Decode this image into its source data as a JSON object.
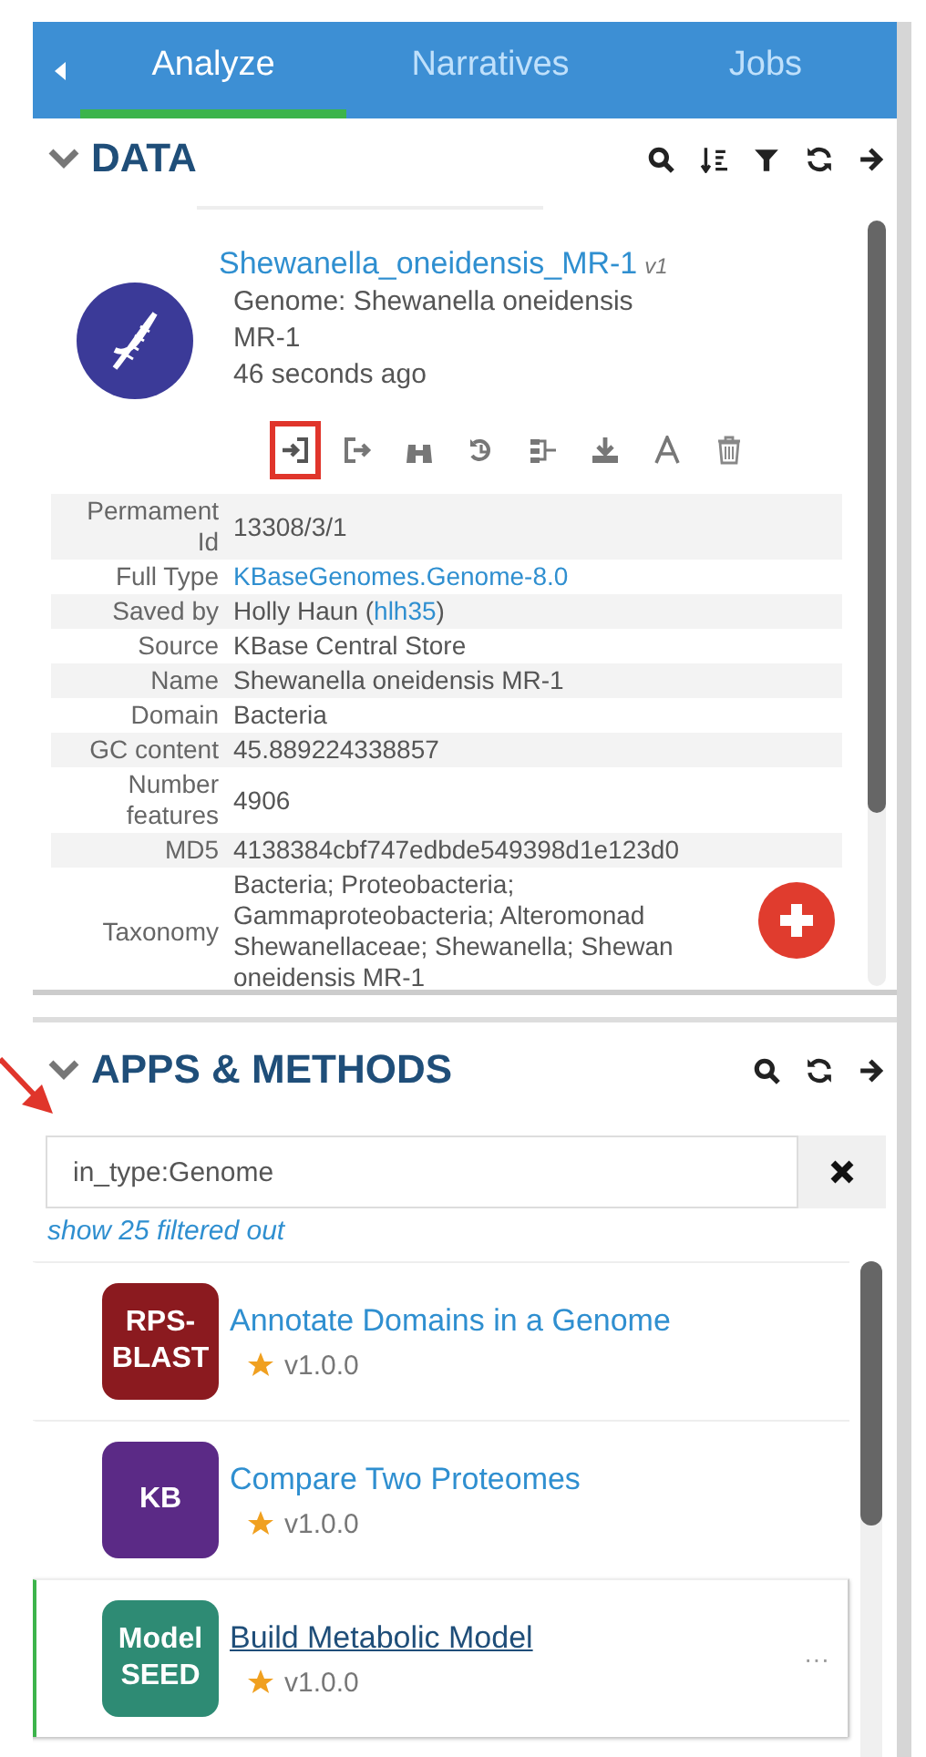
{
  "tabs": [
    {
      "label": "Analyze",
      "selected": true
    },
    {
      "label": "Narratives",
      "selected": false
    },
    {
      "label": "Jobs",
      "selected": false
    }
  ],
  "data": {
    "title": "DATA",
    "expanded": true,
    "object": {
      "name": "Shewanella_oneidensis_MR-1",
      "version": "v1",
      "type_lines": [
        "Genome: Shewanella oneidensis",
        "MR-1"
      ],
      "time": "46 seconds ago"
    },
    "actions": [
      {
        "highlighted": true
      },
      {
        "highlighted": false
      },
      {
        "highlighted": false
      },
      {
        "highlighted": false
      },
      {
        "highlighted": false
      },
      {
        "highlighted": false
      },
      {
        "highlighted": false
      },
      {
        "highlighted": false
      }
    ],
    "rows": [
      {
        "label": "Permament Id",
        "value": [
          {
            "text": "13308/3/1"
          }
        ]
      },
      {
        "label": "Full Type",
        "value": [
          {
            "text": "KBaseGenomes.Genome-8.0",
            "link": true
          }
        ]
      },
      {
        "label": "Saved by",
        "value": [
          {
            "text": "Holly Haun ("
          },
          {
            "text": "hlh35",
            "link": true
          },
          {
            "text": ")"
          }
        ]
      },
      {
        "label": "Source",
        "value": [
          {
            "text": "KBase Central Store"
          }
        ]
      },
      {
        "label": "Name",
        "value": [
          {
            "text": "Shewanella oneidensis MR-1"
          }
        ]
      },
      {
        "label": "Domain",
        "value": [
          {
            "text": "Bacteria"
          }
        ]
      },
      {
        "label": "GC content",
        "value": [
          {
            "text": "45.889224338857"
          }
        ]
      },
      {
        "label": "Number features",
        "value": [
          {
            "text": "4906"
          }
        ]
      },
      {
        "label": "MD5",
        "value": [
          {
            "text": "4138384cbf747edbde549398d1e123d0"
          }
        ]
      },
      {
        "label": "Taxonomy",
        "lines": [
          "Bacteria; Proteobacteria;",
          "Gammaproteobacteria; Alteromonad",
          "Shewanellaceae; Shewanella; Shewan",
          "oneidensis MR-1"
        ]
      }
    ]
  },
  "apps": {
    "title": "APPS & METHODS",
    "expanded": true,
    "filter": {
      "value": "in_type:Genome"
    },
    "filtered_link": "show 25 filtered out",
    "items": [
      {
        "logo": [
          "RPS-",
          "BLAST"
        ],
        "color": "#8b1a1f",
        "title": "Annotate Domains in a Genome",
        "version": "v1.0.0",
        "selected": false
      },
      {
        "logo": [
          "KB"
        ],
        "color": "#5b2a86",
        "title": "Compare Two Proteomes",
        "version": "v1.0.0",
        "selected": false
      },
      {
        "logo": [
          "Model",
          "SEED"
        ],
        "color": "#2e8b74",
        "title": "Build Metabolic Model",
        "version": "v1.0.0",
        "selected": true,
        "menu": "···"
      }
    ]
  }
}
